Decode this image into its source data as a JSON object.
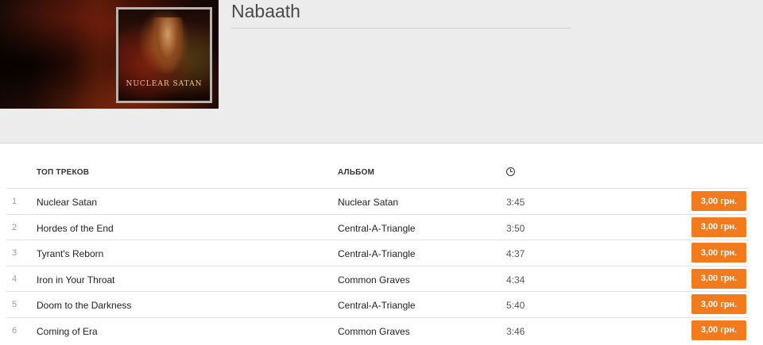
{
  "artist": {
    "name": "Nabaath",
    "cover_label": "NUCLEAR SATAN"
  },
  "table": {
    "headers": {
      "track": "ТОП ТРЕКОВ",
      "album": "АЛЬБОМ",
      "duration_icon": "clock-icon"
    },
    "rows": [
      {
        "num": "1",
        "track": "Nuclear Satan",
        "album": "Nuclear Satan",
        "duration": "3:45",
        "price": "3,00 грн."
      },
      {
        "num": "2",
        "track": "Hordes of the End",
        "album": "Central-A-Triangle",
        "duration": "3:50",
        "price": "3,00 грн."
      },
      {
        "num": "3",
        "track": "Tyrant's Reborn",
        "album": "Central-A-Triangle",
        "duration": "4:37",
        "price": "3,00 грн."
      },
      {
        "num": "4",
        "track": "Iron in Your Throat",
        "album": "Common Graves",
        "duration": "4:34",
        "price": "3,00 грн."
      },
      {
        "num": "5",
        "track": "Doom to the Darkness",
        "album": "Central-A-Triangle",
        "duration": "5:40",
        "price": "3,00 грн."
      },
      {
        "num": "6",
        "track": "Coming of Era",
        "album": "Common Graves",
        "duration": "3:46",
        "price": "3,00 грн."
      }
    ]
  },
  "colors": {
    "buy_button": "#f37b1d",
    "header_bg": "#ececec"
  }
}
